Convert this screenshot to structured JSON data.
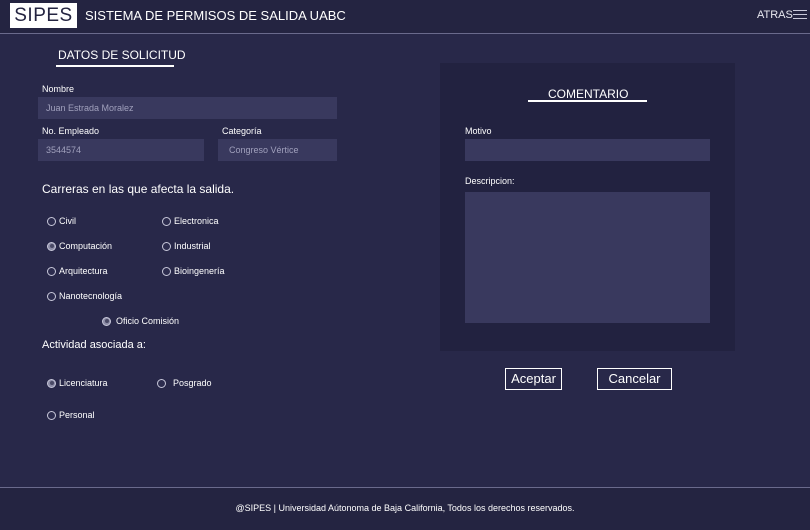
{
  "header": {
    "logo": "SIPES",
    "title": "SISTEMA DE PERMISOS DE SALIDA UABC",
    "back_label": "ATRAS"
  },
  "request": {
    "section_title": "DATOS DE SOLICITUD",
    "name_label": "Nombre",
    "name_value": "Juan   Estrada   Moralez",
    "employee_label": "No. Empleado",
    "employee_value": "3544574",
    "category_label": "Categoría",
    "category_value": "Congreso Vértice"
  },
  "careers": {
    "question": "Carreras en las que afecta la salida.",
    "options": [
      {
        "label": "Civil",
        "checked": false
      },
      {
        "label": "Electronica",
        "checked": false
      },
      {
        "label": "Computación",
        "checked": true
      },
      {
        "label": "Industrial",
        "checked": false
      },
      {
        "label": "Arquitectura",
        "checked": false
      },
      {
        "label": "Bioingenería",
        "checked": false
      },
      {
        "label": "Nanotecnología",
        "checked": false
      },
      {
        "label": "Oficio Comisión",
        "checked": true
      }
    ]
  },
  "activity": {
    "question": "Actividad asociada a:",
    "options": [
      {
        "label": "Licenciatura",
        "checked": true
      },
      {
        "label": "Posgrado",
        "checked": false
      },
      {
        "label": "Personal",
        "checked": false
      }
    ]
  },
  "comment": {
    "title": "COMENTARIO",
    "motivo_label": "Motivo",
    "motivo_value": "",
    "description_label": "Descripcion:",
    "description_value": ""
  },
  "actions": {
    "accept_label": "Aceptar",
    "cancel_label": "Cancelar"
  },
  "footer": {
    "text": "@SIPES |  Universidad Aútonoma de Baja California, Todos los derechos reservados."
  }
}
